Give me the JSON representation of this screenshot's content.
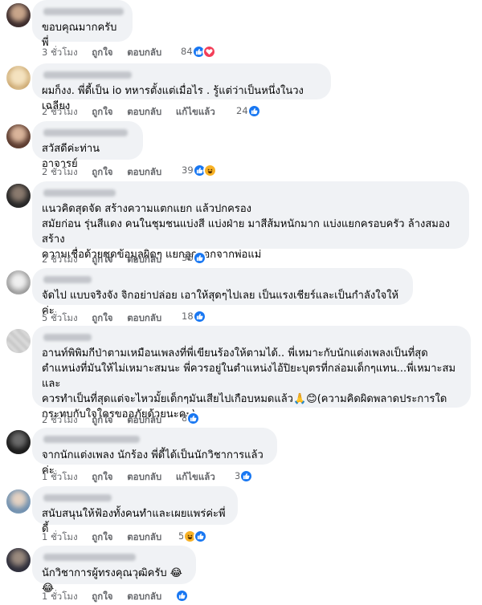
{
  "comments": [
    {
      "text": "ขอบคุณมากครับ พี่",
      "time": "3 ชั่วโมง",
      "like": "ถูกใจ",
      "reply": "ตอบกลับ",
      "edited": "",
      "reaction_count": "84",
      "reactions": [
        "like-icon",
        "love-icon"
      ]
    },
    {
      "text": "ผมก็งง. พี่ดี้เป็น io ทหารตั้งแต่เมื่อไร . รู้แต่ว่าเป็นหนึ่งในวงเฉลียง",
      "time": "2 ชั่วโมง",
      "like": "ถูกใจ",
      "reply": "ตอบกลับ",
      "edited": "แก้ไขแล้ว",
      "reaction_count": "24",
      "reactions": [
        "like-icon"
      ]
    },
    {
      "text": "สวัสดีค่ะท่านอาจารย์",
      "time": "2 ชั่วโมง",
      "like": "ถูกใจ",
      "reply": "ตอบกลับ",
      "edited": "",
      "reaction_count": "39",
      "reactions": [
        "like-icon",
        "haha-icon"
      ]
    },
    {
      "text": "แนวคิดสุดจัด สร้างความแตกแยก แล้วปกครอง\nสมัยก่อน รุ่นสีแดง คนในชุมชนแบ่งสี แบ่งฝ่าย มาสีส้มหนักมาก แบ่งแยกครอบครัว ล้างสมองสร้าง\nความเชื่อด้วยชุดข้อมูลผิดๆ แยกลูกออกจากพ่อแม่",
      "time": "2 ชั่วโมง",
      "like": "ถูกใจ",
      "reply": "ตอบกลับ",
      "edited": "",
      "reaction_count": "36",
      "reactions": [
        "like-icon"
      ]
    },
    {
      "text": "จัดไป แบบจริงจัง จิกอย่าปล่อย เอาให้สุดๆไปเลย เป็นแรงเชียร์และเป็นกำลังใจให้ค่ะ",
      "time": "5 ชั่วโมง",
      "like": "ถูกใจ",
      "reply": "ตอบกลับ",
      "edited": "",
      "reaction_count": "18",
      "reactions": [
        "like-icon"
      ]
    },
    {
      "text": "อานท์พิพิมกีป่าตามเหมือนเพลงที่พี่เขียนร้องให้ตามได้.. พี่เหมาะกับนักแต่งเพลงเป็นที่สุด\nตำแหน่งที่มันให้ไม่เหมาะสมนะ พี่ควรอยู่ในตำแหน่งไอ้ปิยะบุตรที่กล่อมเด็กๆแทน...พี่เหมาะสมและ\nควรทำเป็นที่สุดแต่จะไหวมั้ยเด็กๆมันเสียไปเกือบหมดแล้ว🙏😊(ความคิดผิดพลาดประการใด\nกระทบกับใจใครขออภัยด้วยนะคะ)",
      "time": "2 ชั่วโมง",
      "like": "ถูกใจ",
      "reply": "ตอบกลับ",
      "edited": "",
      "reaction_count": "8",
      "reactions": [
        "like-icon"
      ]
    },
    {
      "text": "จากนักแต่งเพลง นักร้อง พี่ดี้ได้เป็นนักวิชาการแล้วค่ะ",
      "time": "1 ชั่วโมง",
      "like": "ถูกใจ",
      "reply": "ตอบกลับ",
      "edited": "แก้ไขแล้ว",
      "reaction_count": "3",
      "reactions": [
        "like-icon"
      ]
    },
    {
      "text": "สนับสนุนให้ฟ้องทั้งคนทำและเผยแพร่ค่ะพี่ดี้",
      "time": "1 ชั่วโมง",
      "like": "ถูกใจ",
      "reply": "ตอบกลับ",
      "edited": "",
      "reaction_count": "5",
      "reactions": [
        "haha-icon",
        "like-icon"
      ]
    },
    {
      "text": "นักวิชาการผู้ทรงคุณวุฒิครับ 😂😂",
      "time": "1 ชั่วโมง",
      "like": "ถูกใจ",
      "reply": "ตอบกลับ",
      "edited": "",
      "reaction_count": "",
      "reactions": [
        "like-icon"
      ]
    }
  ],
  "colors": {
    "bubble": "#f0f2f5",
    "meta_text": "#65676b",
    "like_blue": "#1877f2",
    "love_red": "#f33e58",
    "haha_yellow": "#f7b125"
  }
}
